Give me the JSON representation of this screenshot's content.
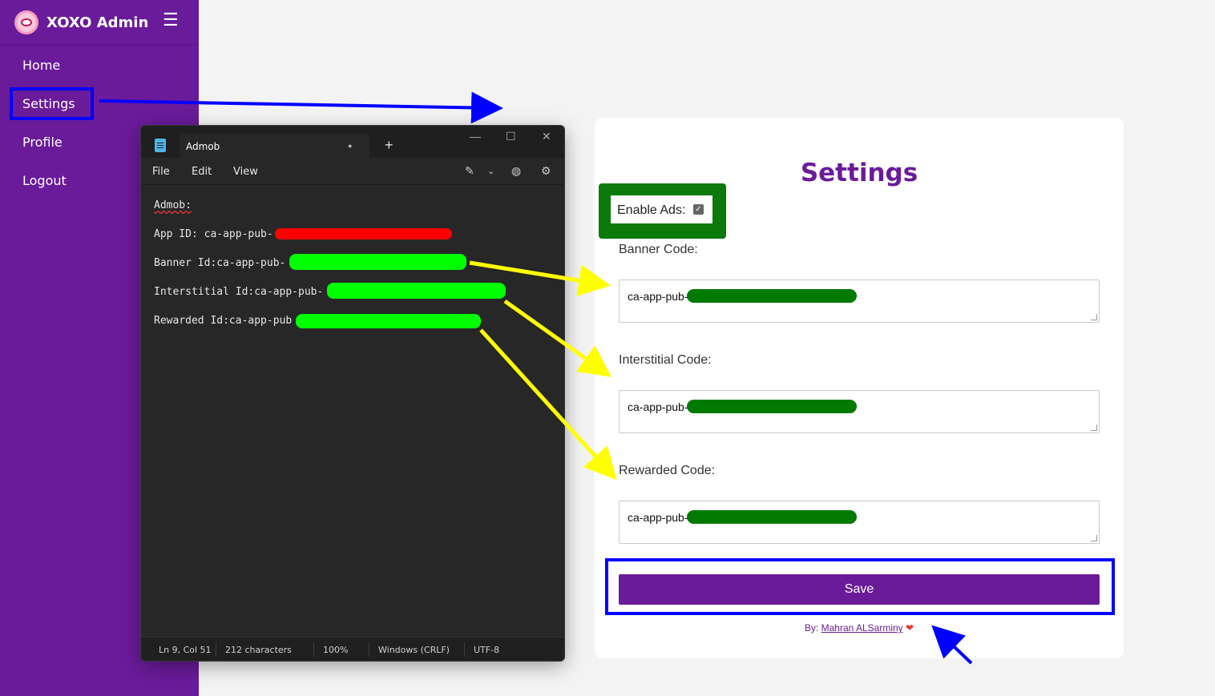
{
  "sidebar": {
    "brand": "XOXO Admin",
    "menu_icon": "hamburger-icon",
    "items": [
      {
        "label": "Home"
      },
      {
        "label": "Settings"
      },
      {
        "label": "Profile"
      },
      {
        "label": "Logout"
      }
    ],
    "background": "#6a1b9a"
  },
  "notepad": {
    "tab_title": "Admob",
    "menu": [
      "File",
      "Edit",
      "View"
    ],
    "lines": [
      "Admob:",
      "App ID: ca-app-pub-",
      "Banner Id:ca-app-pub-",
      "Interstitial Id:ca-app-pub-",
      "Rewarded Id:ca-app-pub"
    ],
    "status": {
      "position": "Ln 9, Col 51",
      "characters": "212 characters",
      "zoom": "100%",
      "line_ending": "Windows (CRLF)",
      "encoding": "UTF-8"
    }
  },
  "settings": {
    "title": "Settings",
    "enable_ads_label": "Enable Ads:",
    "enable_ads_checked": true,
    "fields": [
      {
        "label": "Banner Code:",
        "value": "ca-app-pub-"
      },
      {
        "label": "Interstitial Code:",
        "value": "ca-app-pub-"
      },
      {
        "label": "Rewarded Code:",
        "value": "ca-app-pub-"
      }
    ],
    "save_label": "Save",
    "credit_prefix": "By:",
    "credit_name": "Mahran ALSarminy",
    "accent": "#6a1b9a"
  },
  "annotations": {
    "highlight_color": "#0000ff",
    "arrow_yellow": "#ffff00",
    "smear_red": "#ff0000",
    "smear_green": "#00ff00",
    "smear_darkgreen": "#007a00"
  }
}
